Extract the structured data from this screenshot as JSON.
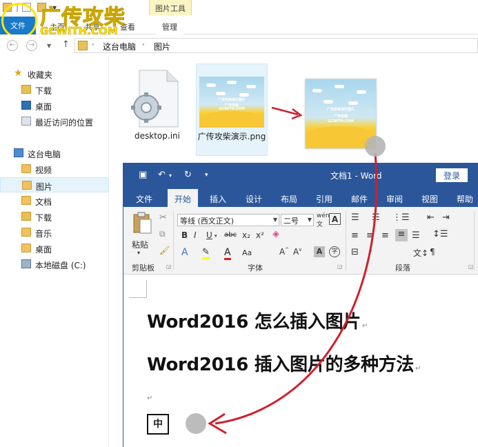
{
  "explorer": {
    "watermark_title": "广传攻柴",
    "watermark_sub": "GCWITH.COM",
    "context_group": "图片工具",
    "tabs": [
      "文件",
      "主页",
      "共享",
      "查看",
      "管理"
    ],
    "breadcrumbs": [
      "这台电脑",
      "图片"
    ],
    "nav": {
      "favorites_label": "收藏夹",
      "favorites": [
        "下载",
        "桌面",
        "最近访问的位置"
      ],
      "pc_label": "这台电脑",
      "pc_items": [
        "视频",
        "图片",
        "文档",
        "下载",
        "音乐",
        "桌面",
        "本地磁盘 (C:)"
      ],
      "selected": "图片"
    },
    "files": [
      {
        "name": "desktop.ini",
        "icon": "settings-file-icon"
      },
      {
        "name": "广传攻柴演示.png",
        "icon": "image-thumbnail"
      }
    ],
    "thumb_text": {
      "line1": "广传攻柴演示图片",
      "line2": "广传攻柴",
      "line3": "GCWITH.COM"
    }
  },
  "word": {
    "title": "文档1 - Word",
    "login": "登录",
    "tabs": [
      "文件",
      "开始",
      "插入",
      "设计",
      "布局",
      "引用",
      "邮件",
      "审阅",
      "视图",
      "帮助"
    ],
    "active_tab": "开始",
    "font_name": "等线 (西文正文)",
    "font_size": "二号",
    "paste_label": "粘贴",
    "groups": [
      "剪贴板",
      "字体",
      "段落"
    ],
    "doc_lines": [
      "Word2016 怎么插入图片",
      "Word2016 插入图片的多种方法"
    ],
    "ime_char": "中"
  },
  "colors": {
    "word_blue": "#2b579a",
    "arrow_red": "#d11f2b",
    "explorer_file_tab": "#1979ca",
    "context_yellow": "#fbf5c4"
  }
}
